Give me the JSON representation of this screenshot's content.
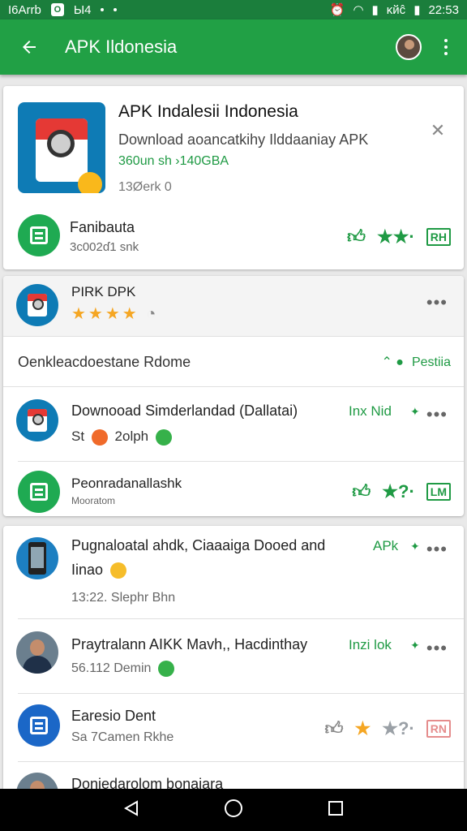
{
  "status_bar": {
    "left_text": "I6Arrb",
    "mid_text": "Ы4",
    "right_text": "ĸйĉ",
    "time": "22:53"
  },
  "app_bar": {
    "title": "APK Ildonesia"
  },
  "hero": {
    "title": "APK Indalesii Indonesia",
    "subtitle": "Download aoancatkihy Ilddaaniay APK",
    "size": "360un sh ›140GBA",
    "meta": "13Øerk 0"
  },
  "card1_row": {
    "title": "Fanibauta",
    "sub": "3c002ɗ1 snk",
    "badge": "RH"
  },
  "card2": {
    "app_title": "PIRK DPK",
    "section_label": "Oenkleacdoestane Rdome",
    "section_link": "Pestiia",
    "row1_title": "Downooad Simderlandad (Dallatai)",
    "row1_tag": "Inx Nid",
    "row1_sub1": "St",
    "row1_sub2": "2olph",
    "row2_title": "Peonradanallashk",
    "row2_sub": "Mooratom",
    "row2_badge": "LM"
  },
  "card3": {
    "row1_title_line1": "Pugnaloatal ahdk, Ciaaaiga Dooed and",
    "row1_title_line2": "Iinao",
    "row1_tag": "APk",
    "row1_sub": "13:22. Slephr Bhn",
    "row2_title": "Praytralann AIKK Mavh,, Hacdinthay",
    "row2_tag": "Inzi lok",
    "row2_sub": "56.112 Demin",
    "row3_title": "Earesio Dent",
    "row3_sub": "Sa 7Camen Rkhe",
    "row3_badge": "RN",
    "row4_title": "Doniedarolom bonaiara"
  },
  "colors": {
    "app_bar": "#21a045",
    "status_bar": "#1b7e3c",
    "accent_green": "#1f9a44",
    "star": "#f5a623"
  }
}
